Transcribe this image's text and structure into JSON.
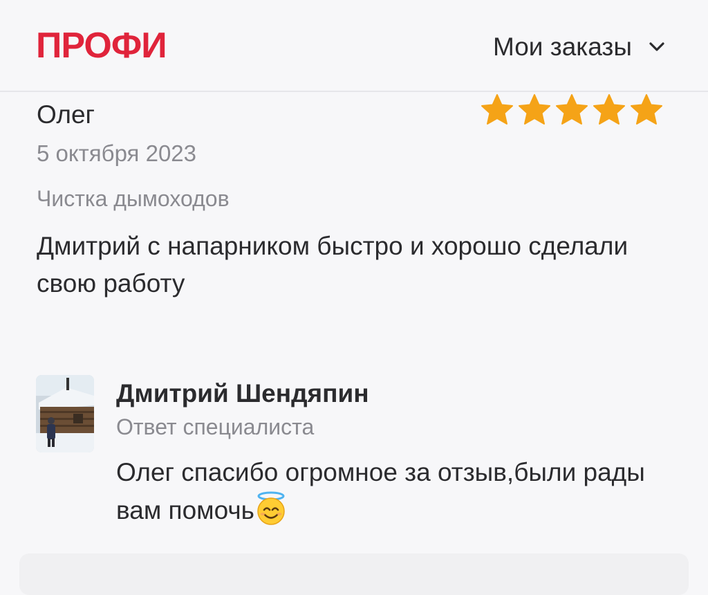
{
  "header": {
    "logo": "ПРОФИ",
    "orders_label": "Мои заказы",
    "chevron_icon": "chevron-down-icon",
    "brand_color": "#e0243b"
  },
  "review": {
    "author": "Олег",
    "rating": 5,
    "rating_max": 5,
    "star_color": "#f5a317",
    "date": "5 октября 2023",
    "service": "Чистка дымоходов",
    "text": "Дмитрий с напарником быстро и хорошо сделали свою работу"
  },
  "reply": {
    "name": "Дмитрий Шендяпин",
    "role": "Ответ специалиста",
    "text": "Олег спасибо огромное за отзыв,были рады вам помочь",
    "emoji_icon": "smiling-face-with-halo-icon",
    "avatar_icon": "specialist-avatar"
  }
}
